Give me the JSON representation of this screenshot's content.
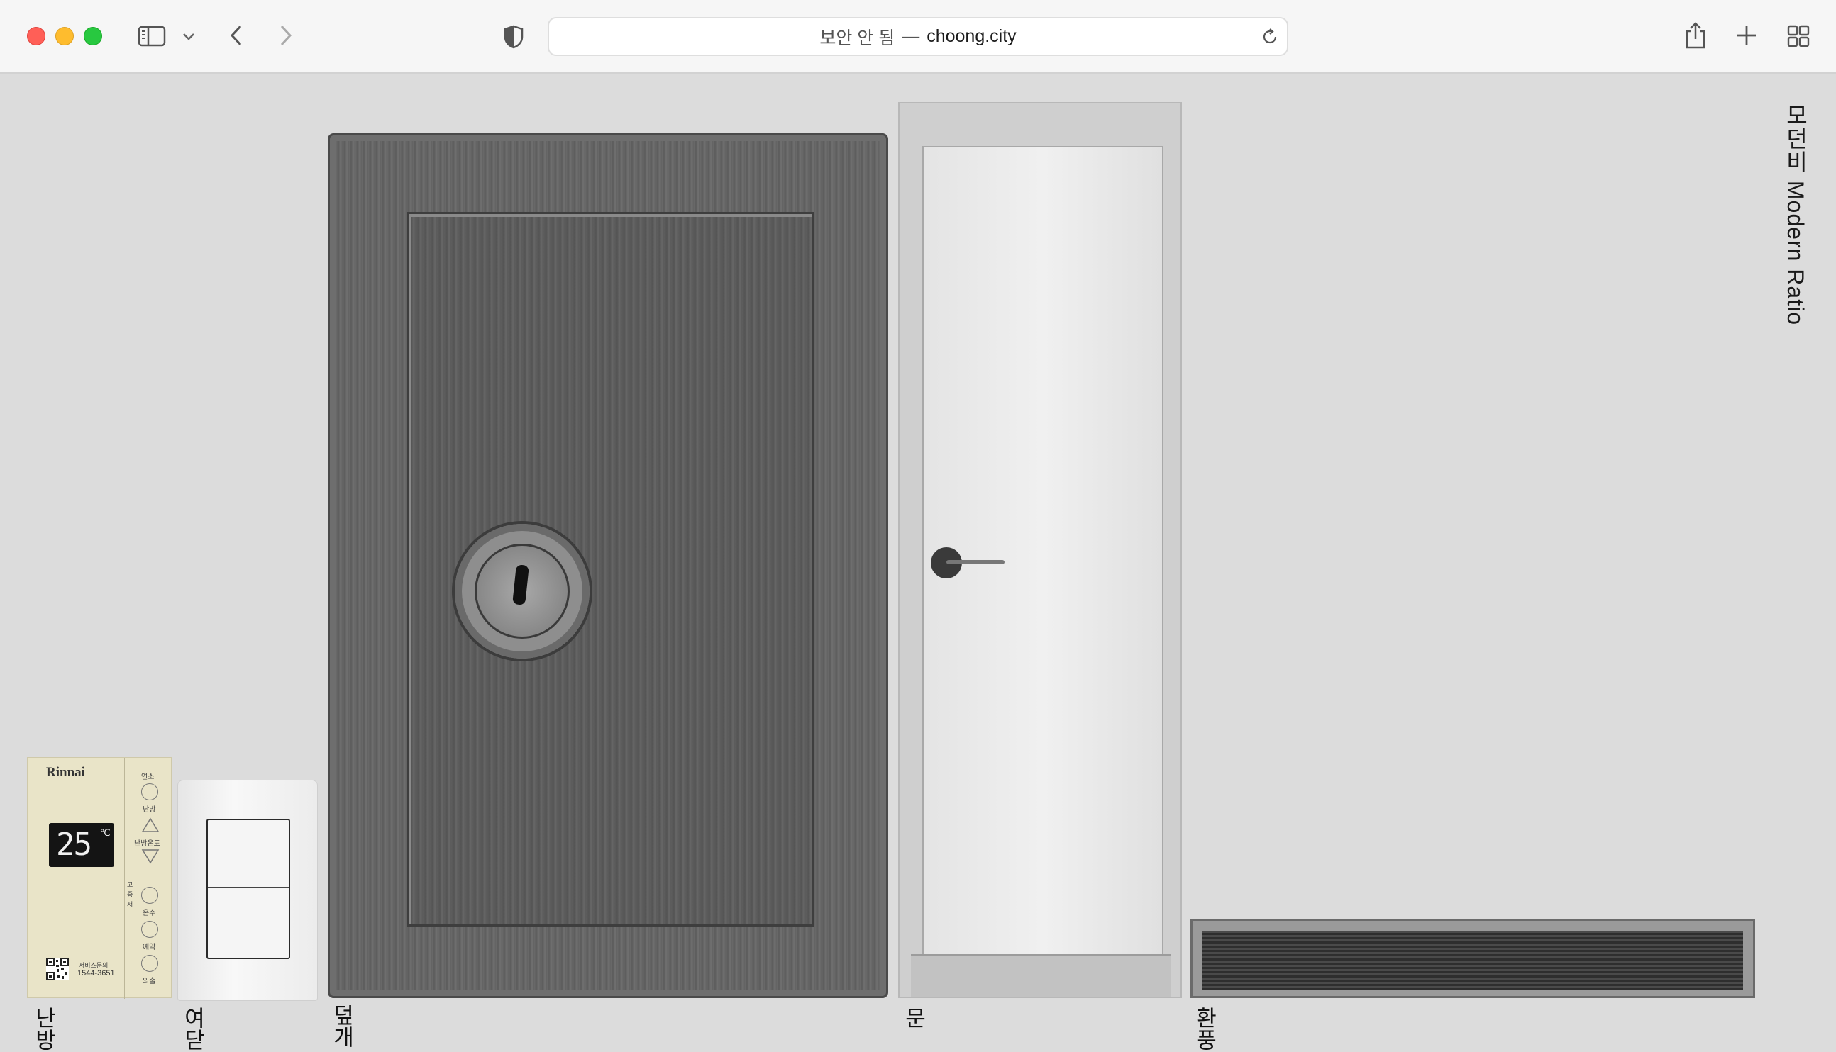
{
  "browser": {
    "address": {
      "security_label": "보안 안 됨",
      "separator": "—",
      "host": "choong.city"
    },
    "icons": [
      "sidebar-icon",
      "chevron-down-icon",
      "back-icon",
      "forward-icon",
      "shield-icon",
      "reload-icon",
      "share-icon",
      "new-tab-icon",
      "tab-overview-icon"
    ]
  },
  "site": {
    "title": "모던비 Modern Ratio"
  },
  "items": [
    {
      "caption": "난방",
      "thermostat": {
        "brand": "Rinnai",
        "temperature": "25",
        "unit": "℃",
        "phone_label": "서비스문의",
        "phone": "1544-3651",
        "labels": [
          "연소",
          "난방",
          "난방온도",
          "고",
          "중",
          "저",
          "온수",
          "예약",
          "외출"
        ]
      }
    },
    {
      "caption": "여닫"
    },
    {
      "caption": "덮개"
    },
    {
      "caption": "문"
    },
    {
      "caption": "환풍"
    }
  ]
}
